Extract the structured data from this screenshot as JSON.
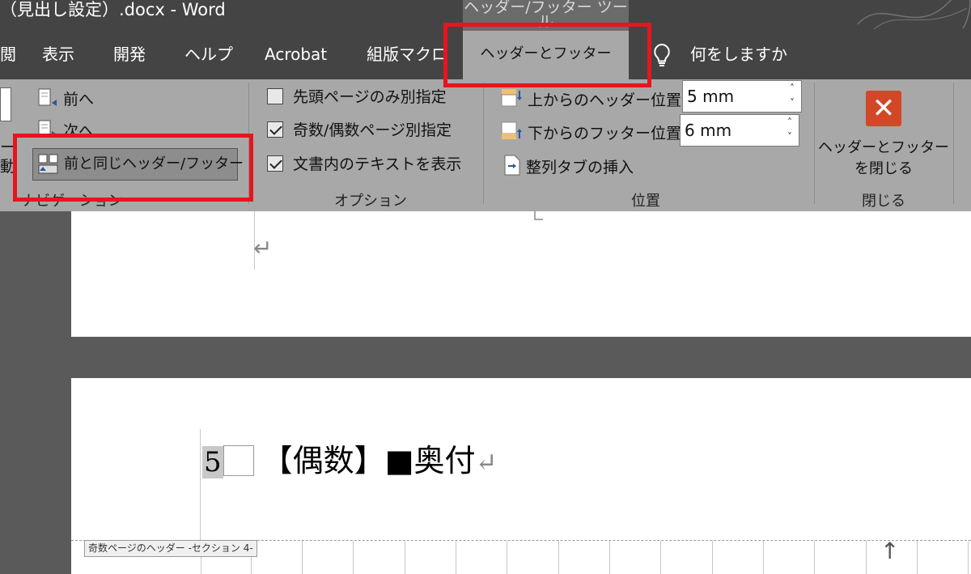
{
  "window": {
    "title": "（見出し設定）.docx  -  Word",
    "context_tab_group": "ヘッダー/フッター ツール"
  },
  "tabs": [
    {
      "label": "閲"
    },
    {
      "label": "表示"
    },
    {
      "label": "開発"
    },
    {
      "label": "ヘルプ"
    },
    {
      "label": "Acrobat"
    },
    {
      "label": "組版マクロ"
    },
    {
      "label": "ヘッダーとフッター",
      "active": true
    }
  ],
  "tell_me": {
    "label": "何をしますか",
    "icon": "lightbulb-icon"
  },
  "ribbon": {
    "navigation": {
      "label": "ナビゲーション",
      "goto_header_label": "ー",
      "goto_footer_label": "動",
      "previous": "前へ",
      "next": "次へ",
      "link_to_previous": "前と同じヘッダー/フッター"
    },
    "options": {
      "label": "オプション",
      "different_first_page": {
        "label": "先頭ページのみ別指定",
        "checked": false
      },
      "different_odd_even": {
        "label": "奇数/偶数ページ別指定",
        "checked": true
      },
      "show_document_text": {
        "label": "文書内のテキストを表示",
        "checked": true
      }
    },
    "position": {
      "label": "位置",
      "header_from_top": {
        "label": "上からのヘッダー位置:",
        "value": "5 mm"
      },
      "footer_from_bottom": {
        "label": "下からのフッター位置:",
        "value": "6 mm"
      },
      "insert_alignment_tab": "整列タブの挿入"
    },
    "close": {
      "label": "閉じる",
      "close_button_line1": "ヘッダーとフッター",
      "close_button_line2": "を閉じる"
    }
  },
  "document": {
    "heading_number": "5",
    "heading_text": "【偶数】■奥付",
    "return_mark": "↵",
    "header_tag": "奇数ページのヘッダー -セクション 4-",
    "up_arrow": "↑"
  },
  "colors": {
    "highlight": "#e8141e",
    "close_icon": "#d24726",
    "ribbon": "#a8a8a8",
    "titlebar": "#444444"
  }
}
